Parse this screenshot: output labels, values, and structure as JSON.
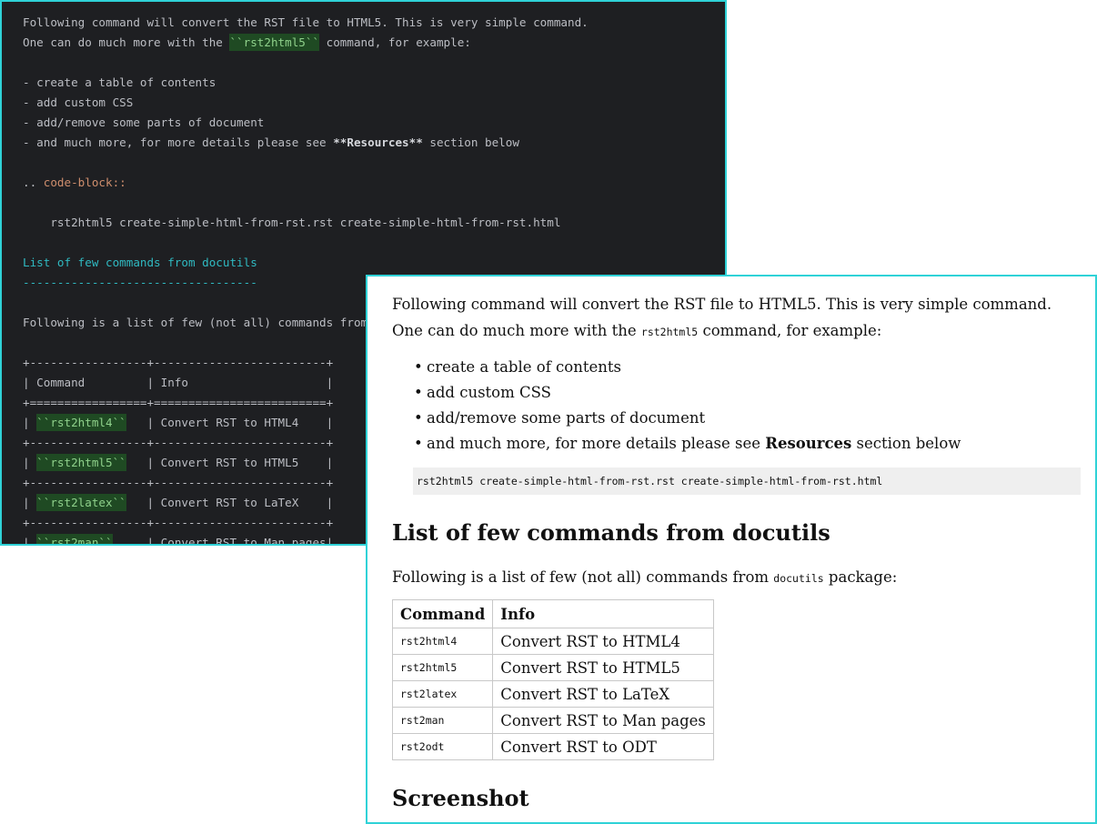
{
  "editor": {
    "lines": [
      {
        "parts": [
          {
            "t": "Following command will convert the RST file to HTML5. This is very simple command."
          }
        ]
      },
      {
        "parts": [
          {
            "t": "One can do much more with the "
          },
          {
            "t": "``rst2html5``",
            "c": "lit"
          },
          {
            "t": " command, for example:"
          }
        ]
      },
      {
        "parts": [
          {
            "t": ""
          }
        ]
      },
      {
        "parts": [
          {
            "t": "- create a table of contents"
          }
        ]
      },
      {
        "parts": [
          {
            "t": "- add custom CSS"
          }
        ]
      },
      {
        "parts": [
          {
            "t": "- add/remove some parts of document"
          }
        ]
      },
      {
        "parts": [
          {
            "t": "- and much more, for more details please see "
          },
          {
            "t": "**Resources**",
            "c": "bold"
          },
          {
            "t": " section below"
          }
        ]
      },
      {
        "parts": [
          {
            "t": ""
          }
        ]
      },
      {
        "parts": [
          {
            "t": ".. "
          },
          {
            "t": "code-block::",
            "c": "directive"
          }
        ]
      },
      {
        "parts": [
          {
            "t": ""
          }
        ]
      },
      {
        "parts": [
          {
            "t": "    rst2html5 create-simple-html-from-rst.rst create-simple-html-from-rst.html"
          }
        ]
      },
      {
        "parts": [
          {
            "t": ""
          }
        ]
      },
      {
        "parts": [
          {
            "t": "List of few commands from docutils",
            "c": "heading"
          }
        ]
      },
      {
        "parts": [
          {
            "t": "----------------------------------",
            "c": "heading"
          }
        ]
      },
      {
        "parts": [
          {
            "t": ""
          }
        ]
      },
      {
        "parts": [
          {
            "t": "Following is a list of few (not all) commands from ``docutils`` package:"
          }
        ]
      },
      {
        "parts": [
          {
            "t": ""
          }
        ]
      },
      {
        "parts": [
          {
            "t": "+-----------------+-------------------------+"
          }
        ]
      },
      {
        "parts": [
          {
            "t": "| Command         | Info                    |"
          }
        ]
      },
      {
        "parts": [
          {
            "t": "+=================+=========================+"
          }
        ]
      },
      {
        "parts": [
          {
            "t": "| "
          },
          {
            "t": "``rst2html4``",
            "c": "lit"
          },
          {
            "t": "   | Convert RST to HTML4    |"
          }
        ]
      },
      {
        "parts": [
          {
            "t": "+-----------------+-------------------------+"
          }
        ]
      },
      {
        "parts": [
          {
            "t": "| "
          },
          {
            "t": "``rst2html5``",
            "c": "lit"
          },
          {
            "t": "   | Convert RST to HTML5    |"
          }
        ]
      },
      {
        "parts": [
          {
            "t": "+-----------------+-------------------------+"
          }
        ]
      },
      {
        "parts": [
          {
            "t": "| "
          },
          {
            "t": "``rst2latex``",
            "c": "lit"
          },
          {
            "t": "   | Convert RST to LaTeX    |"
          }
        ]
      },
      {
        "parts": [
          {
            "t": "+-----------------+-------------------------+"
          }
        ]
      },
      {
        "parts": [
          {
            "t": "| "
          },
          {
            "t": "``rst2man``",
            "c": "lit"
          },
          {
            "t": "     | Convert RST to Man pages|"
          }
        ]
      }
    ]
  },
  "preview": {
    "intro_before": "Following command will convert the RST file to HTML5. This is very simple command. One can do much more with the ",
    "intro_code": "rst2html5",
    "intro_after": " command, for example:",
    "bullets": [
      "create a table of contents",
      "add custom CSS",
      "add/remove some parts of document"
    ],
    "bullet_last_before": "and much more, for more details please see ",
    "bullet_last_bold": "Resources",
    "bullet_last_after": " section below",
    "code_block": "rst2html5 create-simple-html-from-rst.rst create-simple-html-from-rst.html",
    "heading_commands": "List of few commands from docutils",
    "list_intro_before": "Following is a list of few (not all) commands from ",
    "list_intro_code": "docutils",
    "list_intro_after": " package:",
    "table": {
      "headers": [
        "Command",
        "Info"
      ],
      "rows": [
        [
          "rst2html4",
          "Convert RST to HTML4"
        ],
        [
          "rst2html5",
          "Convert RST to HTML5"
        ],
        [
          "rst2latex",
          "Convert RST to LaTeX"
        ],
        [
          "rst2man",
          "Convert RST to Man pages"
        ],
        [
          "rst2odt",
          "Convert RST to ODT"
        ]
      ]
    },
    "heading_screenshot": "Screenshot"
  }
}
